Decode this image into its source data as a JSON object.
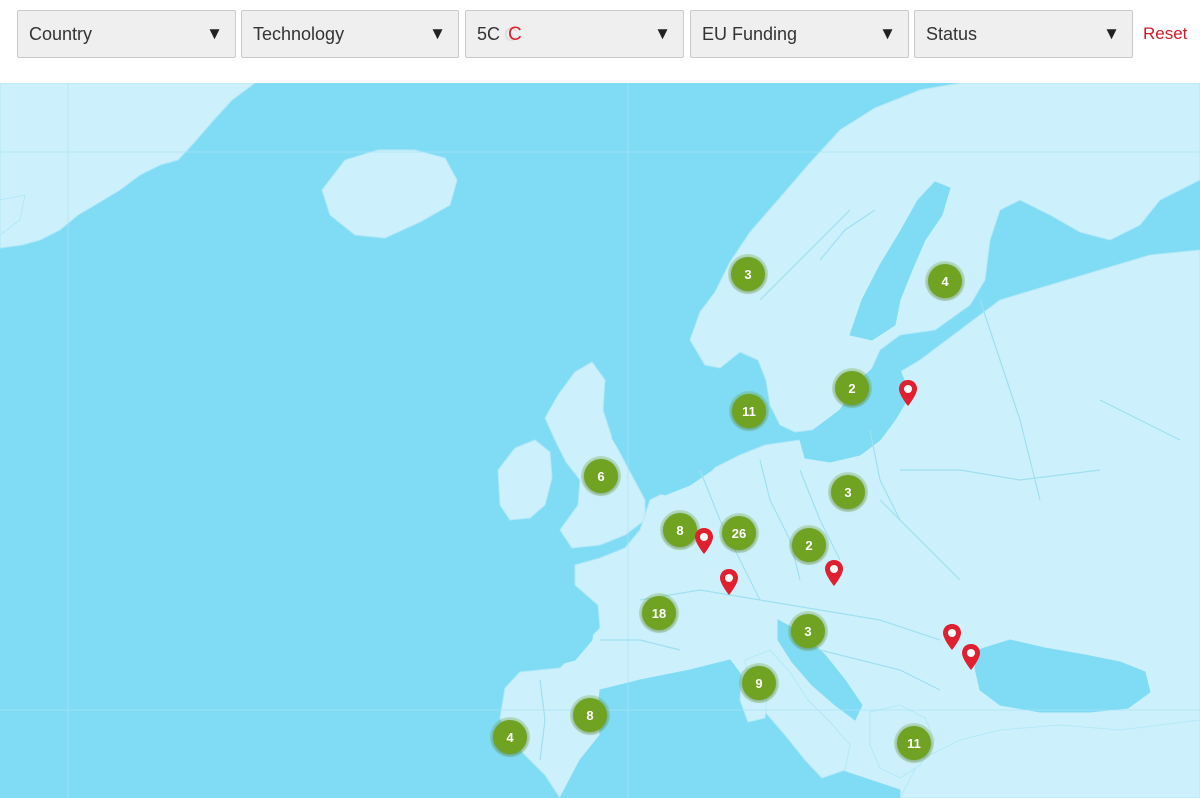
{
  "filters": [
    {
      "label": "Country",
      "caret": "▼"
    },
    {
      "label": "Technology",
      "caret": "▼"
    },
    {
      "label": "5C",
      "caret": "▼",
      "loading_glyph": "C"
    },
    {
      "label": "EU Funding",
      "caret": "▼"
    },
    {
      "label": "Status",
      "caret": "▼"
    }
  ],
  "reset_label": "Reset",
  "colors": {
    "sea": "#80dcf5",
    "land": "#cdf1fc",
    "border": "#9fdff0",
    "cluster": "#6fa321",
    "pin": "#e0202e",
    "reset": "#d11a2a"
  },
  "clusters": [
    {
      "id": "norway",
      "count": "3"
    },
    {
      "id": "finland",
      "count": "4"
    },
    {
      "id": "sweden-south",
      "count": "2"
    },
    {
      "id": "denmark",
      "count": "11"
    },
    {
      "id": "uk",
      "count": "6"
    },
    {
      "id": "poland",
      "count": "3"
    },
    {
      "id": "benelux",
      "count": "8"
    },
    {
      "id": "germany",
      "count": "26"
    },
    {
      "id": "czechia",
      "count": "2"
    },
    {
      "id": "france",
      "count": "18"
    },
    {
      "id": "balkans",
      "count": "3"
    },
    {
      "id": "italy",
      "count": "9"
    },
    {
      "id": "spain",
      "count": "8"
    },
    {
      "id": "portugal",
      "count": "4"
    },
    {
      "id": "greece",
      "count": "11"
    }
  ],
  "pins": [
    {
      "id": "latvia"
    },
    {
      "id": "luxembourg"
    },
    {
      "id": "switzerland"
    },
    {
      "id": "austria"
    },
    {
      "id": "romania"
    },
    {
      "id": "romania-coast"
    }
  ]
}
